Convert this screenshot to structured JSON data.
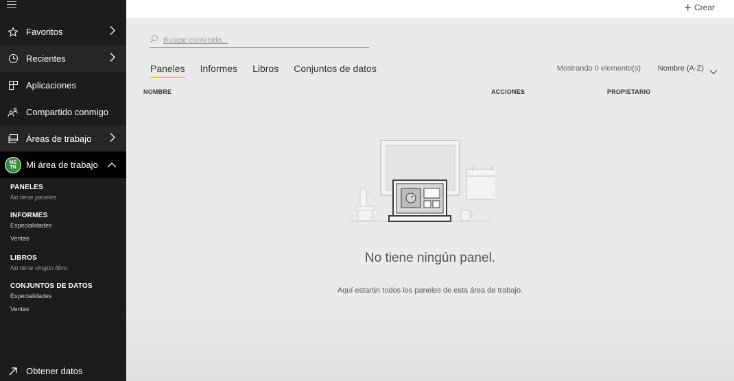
{
  "sidebar": {
    "nav": [
      {
        "label": "Favoritos",
        "icon": "star-icon",
        "chevron": "right"
      },
      {
        "label": "Recientes",
        "icon": "clock-icon",
        "chevron": "right"
      },
      {
        "label": "Aplicaciones",
        "icon": "apps-icon",
        "chevron": ""
      },
      {
        "label": "Compartido conmigo",
        "icon": "shared-people-icon",
        "chevron": ""
      },
      {
        "label": "Áreas de trabajo",
        "icon": "workspaces-icon",
        "chevron": "right"
      }
    ],
    "my_workspace": {
      "label": "Mi área de trabajo",
      "avatar_text_top": "ME",
      "avatar_text_bottom": "TN",
      "avatar_color": "#3a8a3e"
    },
    "sections": {
      "paneles": {
        "heading": "PANELES",
        "empty": "No tiene paneles"
      },
      "informes": {
        "heading": "INFORMES",
        "items": [
          "Especialidades",
          "Ventas"
        ]
      },
      "libros": {
        "heading": "LIBROS",
        "empty": "No tiene ningún libro."
      },
      "conjuntos": {
        "heading": "CONJUNTOS DE DATOS",
        "items": [
          "Especialidades",
          "Ventas"
        ]
      }
    },
    "get_data": "Obtener datos"
  },
  "topbar": {
    "create_label": "Crear"
  },
  "main": {
    "search_placeholder": "Buscar contenido...",
    "tabs": [
      "Paneles",
      "Informes",
      "Libros",
      "Conjuntos de datos"
    ],
    "active_tab_color": "#f2c811",
    "count_text": "Mostrando 0 elemento(s)",
    "sort_label": "Nombre (A-Z)",
    "columns": {
      "name": "NOMBRE",
      "actions": "ACCIONES",
      "owner": "PROPIETARIO"
    },
    "empty_title": "No tiene ningún panel.",
    "empty_subtitle": "Aquí estarán todos los paneles de esta área de trabajo."
  }
}
